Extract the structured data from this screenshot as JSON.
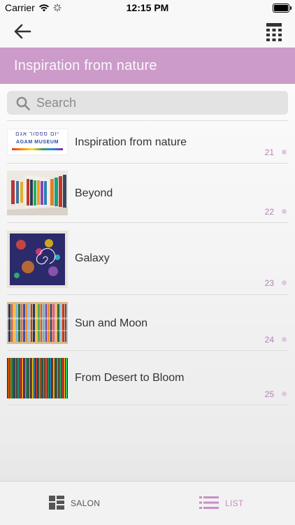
{
  "status_bar": {
    "carrier": "Carrier",
    "time": "12:15 PM"
  },
  "nav": {
    "back_icon": "back-arrow-icon",
    "calculator_icon": "calculator-icon"
  },
  "header": {
    "title": "Inspiration from nature"
  },
  "search": {
    "placeholder": "Search",
    "value": ""
  },
  "items": [
    {
      "title": "Inspiration from nature",
      "count": "21"
    },
    {
      "title": "Beyond",
      "count": "22"
    },
    {
      "title": "Galaxy",
      "count": "23"
    },
    {
      "title": "Sun and Moon",
      "count": "24"
    },
    {
      "title": "From Desert to Bloom",
      "count": "25"
    }
  ],
  "thumbnail_logo": {
    "line1": "יזם ספסור אגם",
    "line2": "AGAM MUSEUM"
  },
  "tabs": {
    "salon": "SALON",
    "list": "LIST",
    "active": "list"
  },
  "colors": {
    "accent": "#cc9bca",
    "active_tab": "#c98fc7",
    "count": "#b083b0"
  }
}
